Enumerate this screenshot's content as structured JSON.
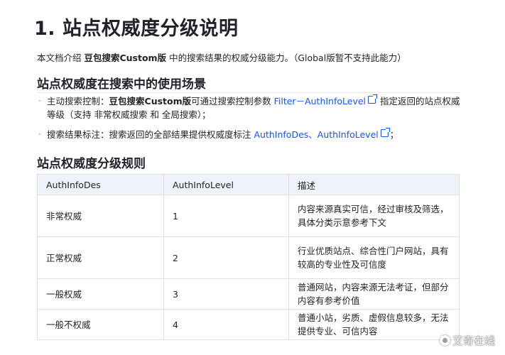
{
  "doc": {
    "title": "1. 站点权威度分级说明",
    "intro": {
      "prefix": "本文档介绍 ",
      "bold": "豆包搜索Custom版",
      "suffix": " 中的搜索结果的权威分级能力。（Global版暂不支持此能力）"
    },
    "section1": {
      "heading": "站点权威度在搜索中的使用场景",
      "bullet_char": "·",
      "items": [
        {
          "label": "主动搜索控制：",
          "bold": "豆包搜索Custom版",
          "text1": "可通过搜索控制参数 ",
          "link": "Filter－AuthInfoLevel",
          "text2": " 指定返回的站点权威等级（支持 非常权威搜索 和 全局搜索）；"
        },
        {
          "label": "搜索结果标注：",
          "text1": "搜索返回的全部结果提供权威度标注 ",
          "link": "AuthInfoDes、AuthInfoLevel",
          "text2": "；"
        }
      ]
    },
    "section2": {
      "heading": "站点权威度分级规则",
      "table": {
        "headers": [
          "AuthInfoDes",
          "AuthInfoLevel",
          "描述"
        ],
        "rows": [
          [
            "非常权威",
            "1",
            "内容来源真实可信，经过审核及筛选，具体分类示意参考下文"
          ],
          [
            "正常权威",
            "2",
            "行业优质站点、综合性门户网站，具有较高的专业性及可信度"
          ],
          [
            "一般权威",
            "3",
            "普通网站，内容来源无法考证，但部分内容有参考价值"
          ],
          [
            "一般不权威",
            "4",
            "普通小站，劣质、虚假信息较多，无法提供专业、可信内容"
          ]
        ]
      }
    }
  },
  "watermark": {
    "text": "艾奇在线",
    "icon": "logo-icon"
  },
  "colors": {
    "link": "#1456f0",
    "header_bg": "#eef2f9",
    "border": "#dee0e3"
  }
}
